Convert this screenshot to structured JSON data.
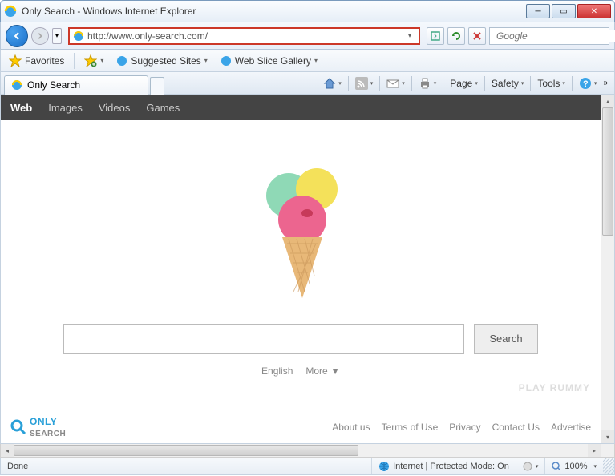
{
  "window": {
    "title": "Only Search - Windows Internet Explorer"
  },
  "address": {
    "url": "http://www.only-search.com/"
  },
  "search_provider": {
    "placeholder": "Google"
  },
  "favorites": {
    "label": "Favorites",
    "suggested": "Suggested Sites",
    "webslice": "Web Slice Gallery"
  },
  "tab": {
    "title": "Only Search"
  },
  "command": {
    "page": "Page",
    "safety": "Safety",
    "tools": "Tools"
  },
  "site": {
    "nav": {
      "web": "Web",
      "images": "Images",
      "videos": "Videos",
      "games": "Games"
    },
    "search_button": "Search",
    "lang": "English",
    "more": "More ▼",
    "logo_only": "ONLY",
    "logo_search": "SEARCH",
    "footer": {
      "about": "About us",
      "terms": "Terms of Use",
      "privacy": "Privacy",
      "contact": "Contact Us",
      "advertise": "Advertise"
    },
    "ghost": "PLAY RUMMY"
  },
  "status": {
    "done": "Done",
    "zone": "Internet | Protected Mode: On",
    "zoom": "100%"
  }
}
